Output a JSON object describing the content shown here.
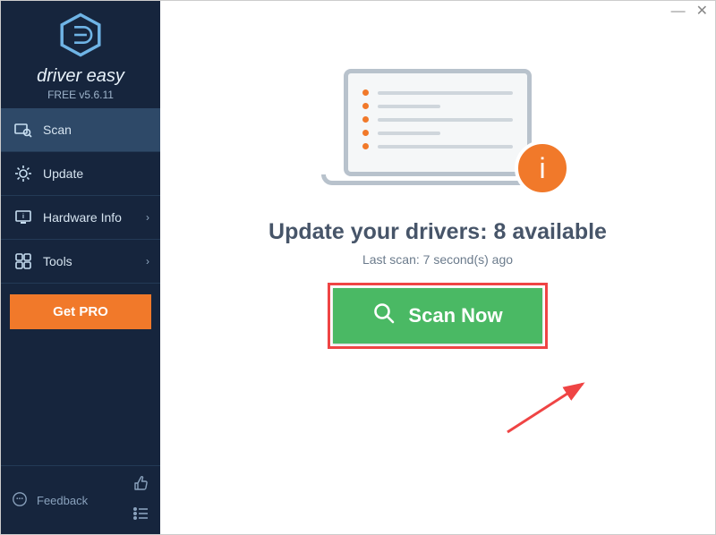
{
  "brand": {
    "name": "driver easy",
    "version": "FREE v5.6.11"
  },
  "sidebar": {
    "items": [
      {
        "label": "Scan"
      },
      {
        "label": "Update"
      },
      {
        "label": "Hardware Info"
      },
      {
        "label": "Tools"
      }
    ],
    "get_pro": "Get PRO",
    "feedback": "Feedback"
  },
  "main": {
    "headline_prefix": "Update your drivers: ",
    "headline_count": "8 available",
    "subline": "Last scan: 7 second(s) ago",
    "scan_button": "Scan Now"
  },
  "colors": {
    "accent": "#f1792a",
    "sidebar_bg": "#16253d",
    "scan_green": "#4ab964",
    "highlight_red": "#ef4444"
  }
}
